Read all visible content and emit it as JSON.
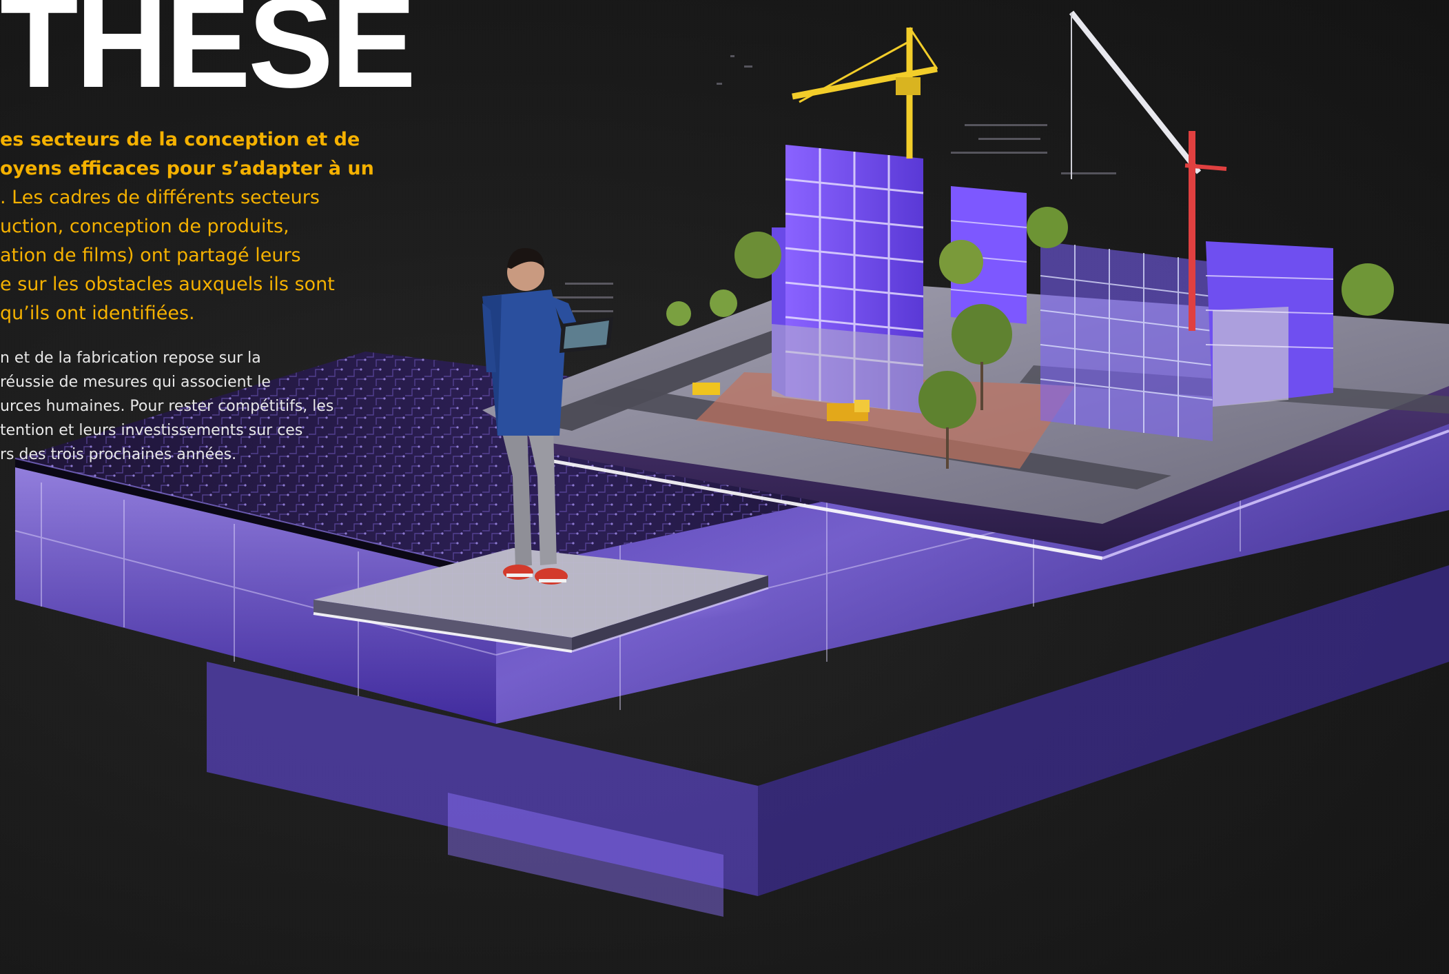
{
  "headline": "THESE",
  "lead": {
    "bold_lines": [
      "es secteurs de la conception et de",
      "oyens efficaces pour s’adapter à un"
    ],
    "regular_lines": [
      ". Les cadres de différents secteurs",
      "uction, conception de produits,",
      "ation de films) ont partagé leurs",
      "e sur les obstacles auxquels ils sont",
      "qu’ils ont identifiées."
    ]
  },
  "body": {
    "lines": [
      "n et de la fabrication repose sur la",
      "réussie de mesures qui associent le",
      "urces humaines. Pour rester compétitifs, les",
      "tention et leurs investissements sur ces",
      "rs des trois prochaines années."
    ]
  },
  "colors": {
    "accent": "#f5b100",
    "headline": "#ffffff",
    "body": "#e8e8e8",
    "background": "#1b1b1b",
    "glow": "#7b5cff"
  }
}
